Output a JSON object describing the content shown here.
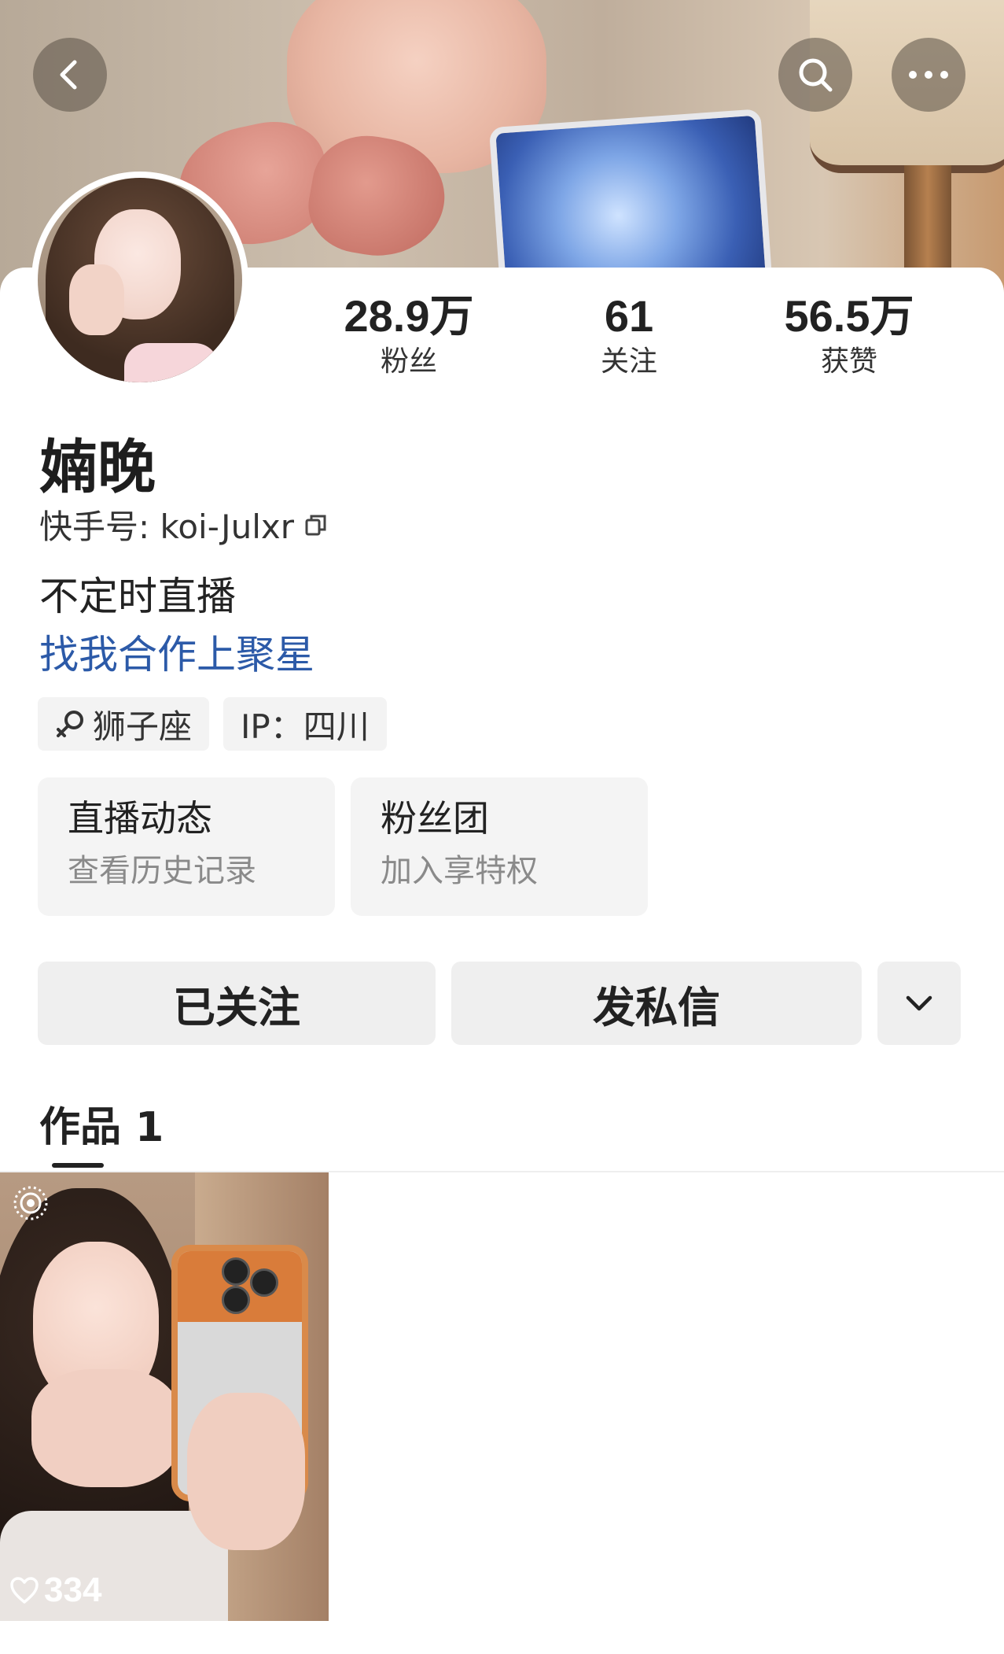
{
  "stats": [
    {
      "value": "28.9万",
      "label": "粉丝"
    },
    {
      "value": "61",
      "label": "关注"
    },
    {
      "value": "56.5万",
      "label": "获赞"
    }
  ],
  "profile": {
    "name": "婻晚",
    "kuaishou_id": "快手号: koi-Julxr",
    "bio_line1": "不定时直播",
    "bio_line2": "找我合作上聚星"
  },
  "tags": [
    {
      "icon": "male-symbol-icon",
      "label": "狮子座"
    },
    {
      "label": "IP：四川"
    }
  ],
  "cards": [
    {
      "title": "直播动态",
      "subtitle": "查看历史记录"
    },
    {
      "title": "粉丝团",
      "subtitle": "加入享特权"
    }
  ],
  "actions": {
    "follow_label": "已关注",
    "message_label": "发私信"
  },
  "tabs": [
    {
      "label": "作品 1",
      "active": true
    }
  ],
  "posts": [
    {
      "likes": "334"
    }
  ],
  "colors": {
    "link": "#2c5aa8",
    "button_bg": "#efefef"
  }
}
